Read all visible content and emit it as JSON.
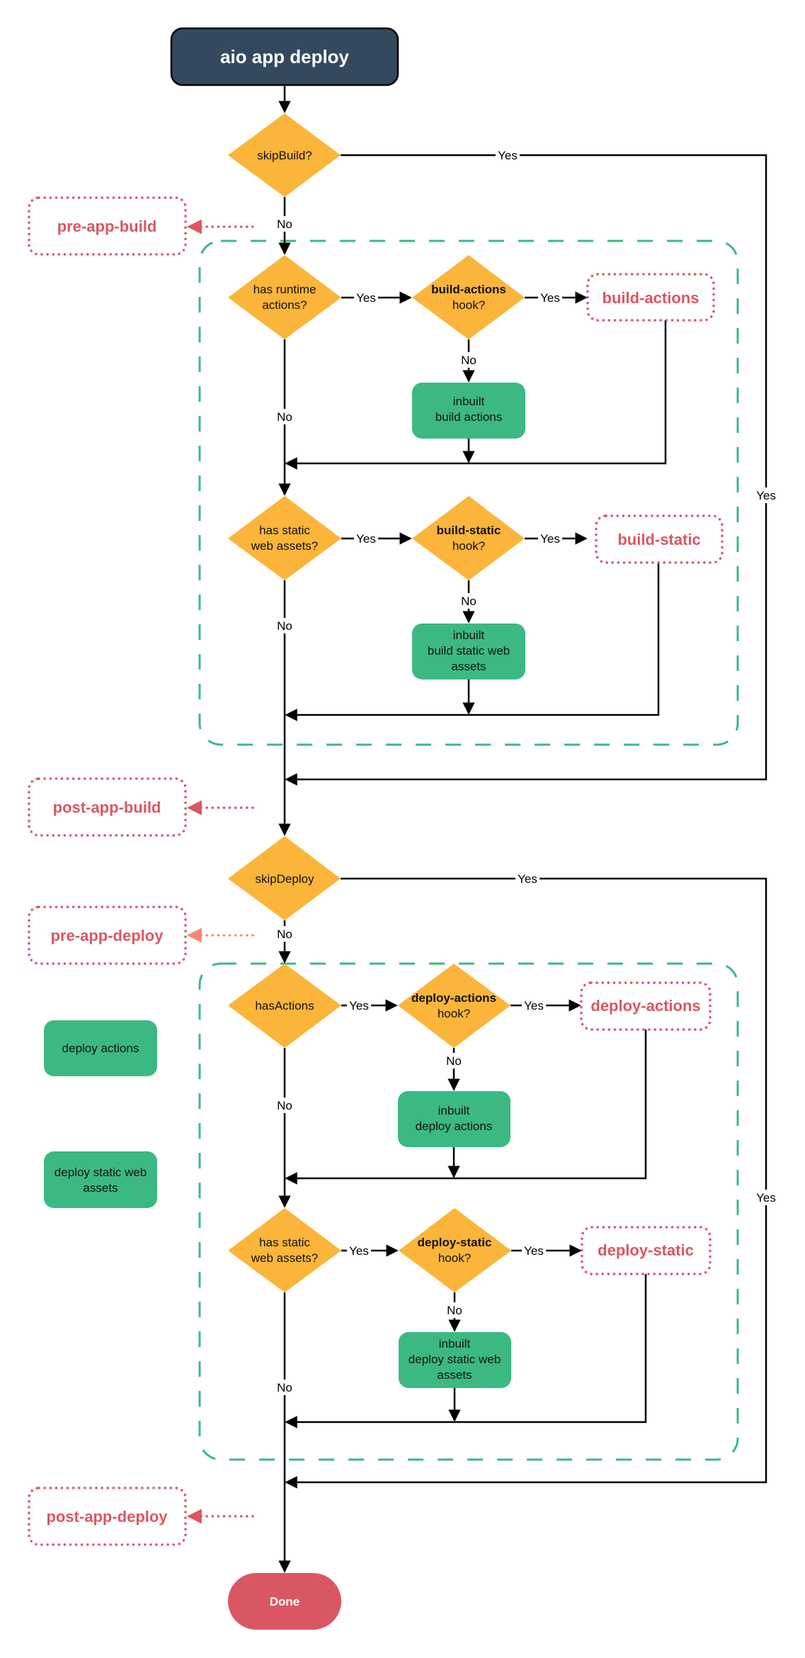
{
  "title": "aio app deploy",
  "colors": {
    "title_bg": "#34495e",
    "decision": "#fbb53a",
    "process": "#3cb982",
    "hook": "#d95763",
    "hook_arrow_pre_deploy": "#f5877a",
    "done": "#d95763"
  },
  "decisions": {
    "skip_build": "skipBuild?",
    "has_runtime_actions": [
      "has runtime",
      "actions?"
    ],
    "build_actions_hook": [
      "build-actions",
      "hook?"
    ],
    "has_static_build": [
      "has static",
      "web assets?"
    ],
    "build_static_hook": [
      "build-static",
      "hook?"
    ],
    "skip_deploy": "skipDeploy",
    "has_actions": "hasActions",
    "deploy_actions_hook": [
      "deploy-actions",
      "hook?"
    ],
    "has_static_deploy": [
      "has static",
      "web assets?"
    ],
    "deploy_static_hook": [
      "deploy-static",
      "hook?"
    ]
  },
  "processes": {
    "inbuilt_build_actions": [
      "inbuilt",
      "build actions"
    ],
    "inbuilt_build_static": [
      "inbuilt",
      "build static web",
      "assets"
    ],
    "inbuilt_deploy_actions": [
      "inbuilt",
      "deploy actions"
    ],
    "inbuilt_deploy_static": [
      "inbuilt",
      "deploy static web",
      "assets"
    ],
    "legend_deploy_actions": [
      "deploy actions"
    ],
    "legend_deploy_static": [
      "deploy static web",
      "assets"
    ]
  },
  "hooks": {
    "pre_app_build": "pre-app-build",
    "build_actions": "build-actions",
    "build_static": "build-static",
    "post_app_build": "post-app-build",
    "pre_app_deploy": "pre-app-deploy",
    "deploy_actions": "deploy-actions",
    "deploy_static": "deploy-static",
    "post_app_deploy": "post-app-deploy"
  },
  "edge_labels": {
    "yes": "Yes",
    "no": "No"
  },
  "terminal": "Done"
}
